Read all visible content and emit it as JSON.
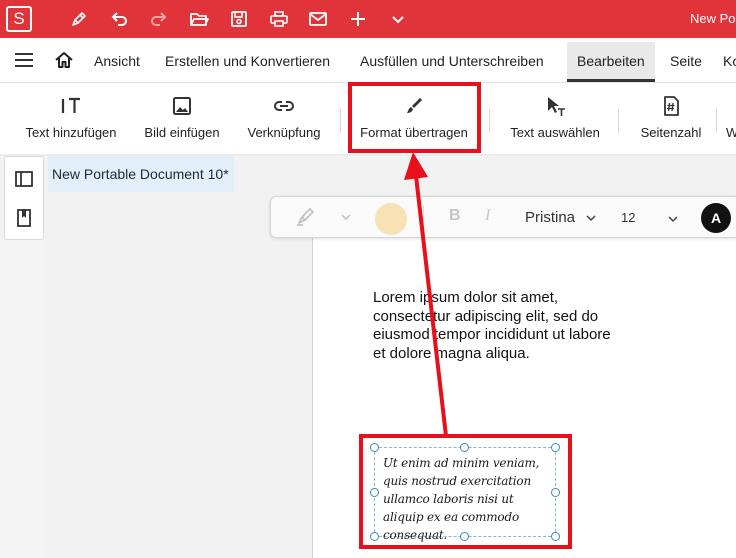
{
  "app": {
    "logo_letter": "S",
    "window_title": "New Po",
    "brand_color": "#e0343a"
  },
  "titlebar_icons": [
    "pen-icon",
    "undo-icon",
    "redo-icon",
    "folder-open-icon",
    "save-icon",
    "print-icon",
    "mail-icon",
    "plus-icon",
    "chevron-down-icon"
  ],
  "menu": {
    "items": [
      "Ansicht",
      "Erstellen und Konvertieren",
      "Ausfüllen und Unterschreiben",
      "Bearbeiten",
      "Seite",
      "Ko"
    ],
    "active": "Bearbeiten"
  },
  "toolbar": {
    "text_hinzufuegen": "Text hinzufügen",
    "bild_einfuegen": "Bild einfügen",
    "verknuepfung": "Verknüpfung",
    "format_uebertragen": "Format übertragen",
    "text_auswaehlen": "Text auswählen",
    "seitenzahl": "Seitenzahl",
    "overflow": "W"
  },
  "document_tab": "New Portable Document 10*",
  "format_bar": {
    "font_name": "Pristina",
    "font_size": "12",
    "avatar_letter": "A",
    "bold": "B",
    "italic": "I",
    "swatch_color": "#f6e2b3"
  },
  "page": {
    "lorem_text": "Lorem ipsum dolor sit amet, consectetur adipiscing elit, sed do eiusmod tempor incididunt ut labore et dolore magna aliqua.",
    "script_text": "Ut enim ad minim veniam, quis nostrud exercitation ullamco laboris nisi ut aliquip ex ea commodo consequat."
  },
  "annotation_color": "#e8101a"
}
